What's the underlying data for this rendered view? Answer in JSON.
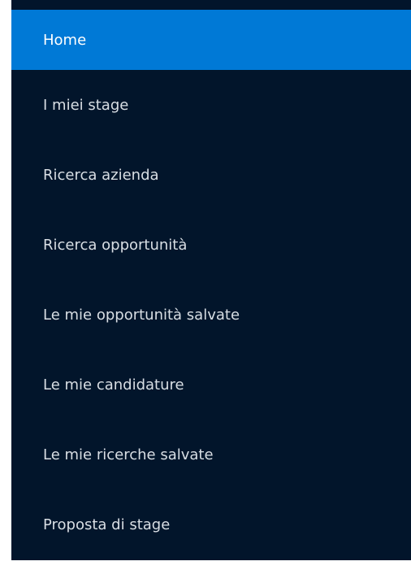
{
  "sidebar": {
    "colors": {
      "background": "#02152b",
      "active_background": "#0079d6",
      "text": "#d9dee4",
      "active_text": "#ffffff"
    },
    "items": [
      {
        "label": "Home",
        "active": true
      },
      {
        "label": "I miei stage",
        "active": false
      },
      {
        "label": "Ricerca azienda",
        "active": false
      },
      {
        "label": "Ricerca opportunità",
        "active": false
      },
      {
        "label": "Le mie opportunità salvate",
        "active": false
      },
      {
        "label": "Le mie candidature",
        "active": false
      },
      {
        "label": "Le mie ricerche salvate",
        "active": false
      },
      {
        "label": "Proposta di stage",
        "active": false
      }
    ]
  }
}
